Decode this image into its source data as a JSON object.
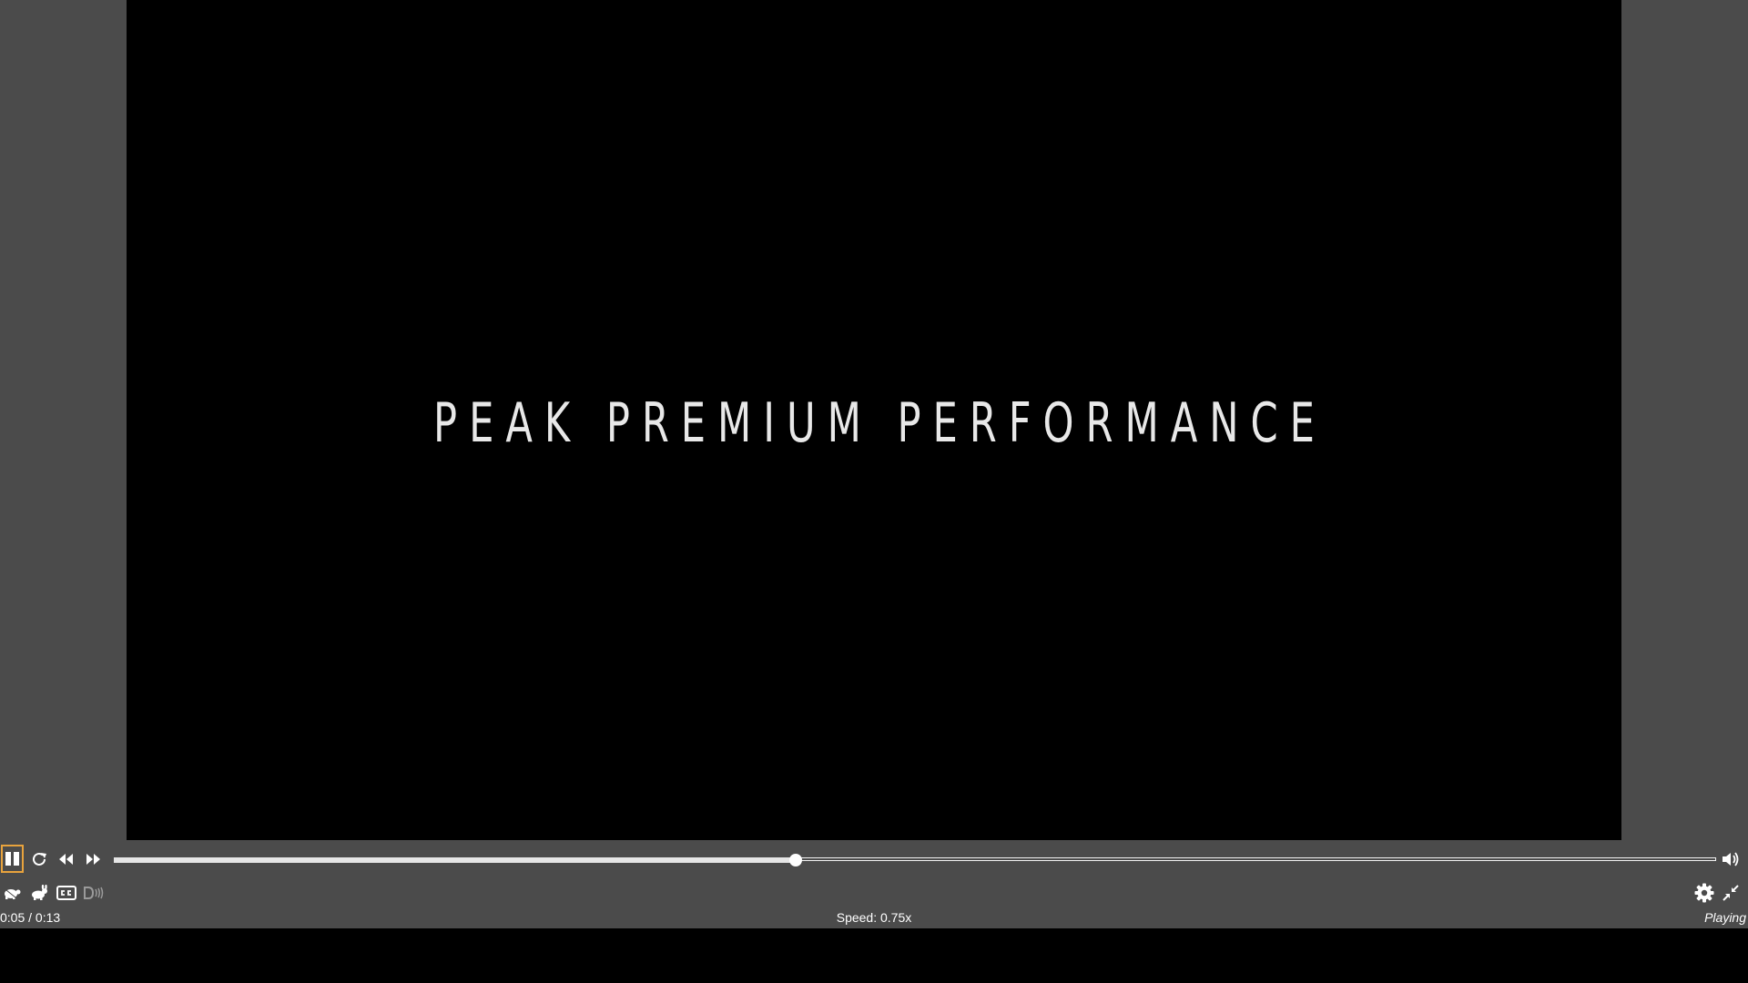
{
  "video": {
    "title_text": "PEAK PREMIUM PERFORMANCE"
  },
  "controls": {
    "play_pause_icon": "pause-icon",
    "restart_icon": "restart-icon",
    "rewind_icon": "rewind-icon",
    "forward_icon": "fast-forward-icon",
    "volume_icon": "volume-icon",
    "slower_icon": "turtle-icon",
    "faster_icon": "rabbit-icon",
    "captions_icon": "cc-icon",
    "description_icon": "audio-description-icon",
    "settings_icon": "gear-icon",
    "fullscreen_icon": "exit-fullscreen-icon",
    "progress_fraction": 0.4255
  },
  "status": {
    "time": "0:05 / 0:13",
    "speed": "Speed: 0.75x",
    "state": "Playing"
  },
  "colors": {
    "chrome_bg": "#4b4b4b",
    "focus_ring": "#e8a33d",
    "video_bg": "#000000",
    "text": "#ffffff"
  }
}
